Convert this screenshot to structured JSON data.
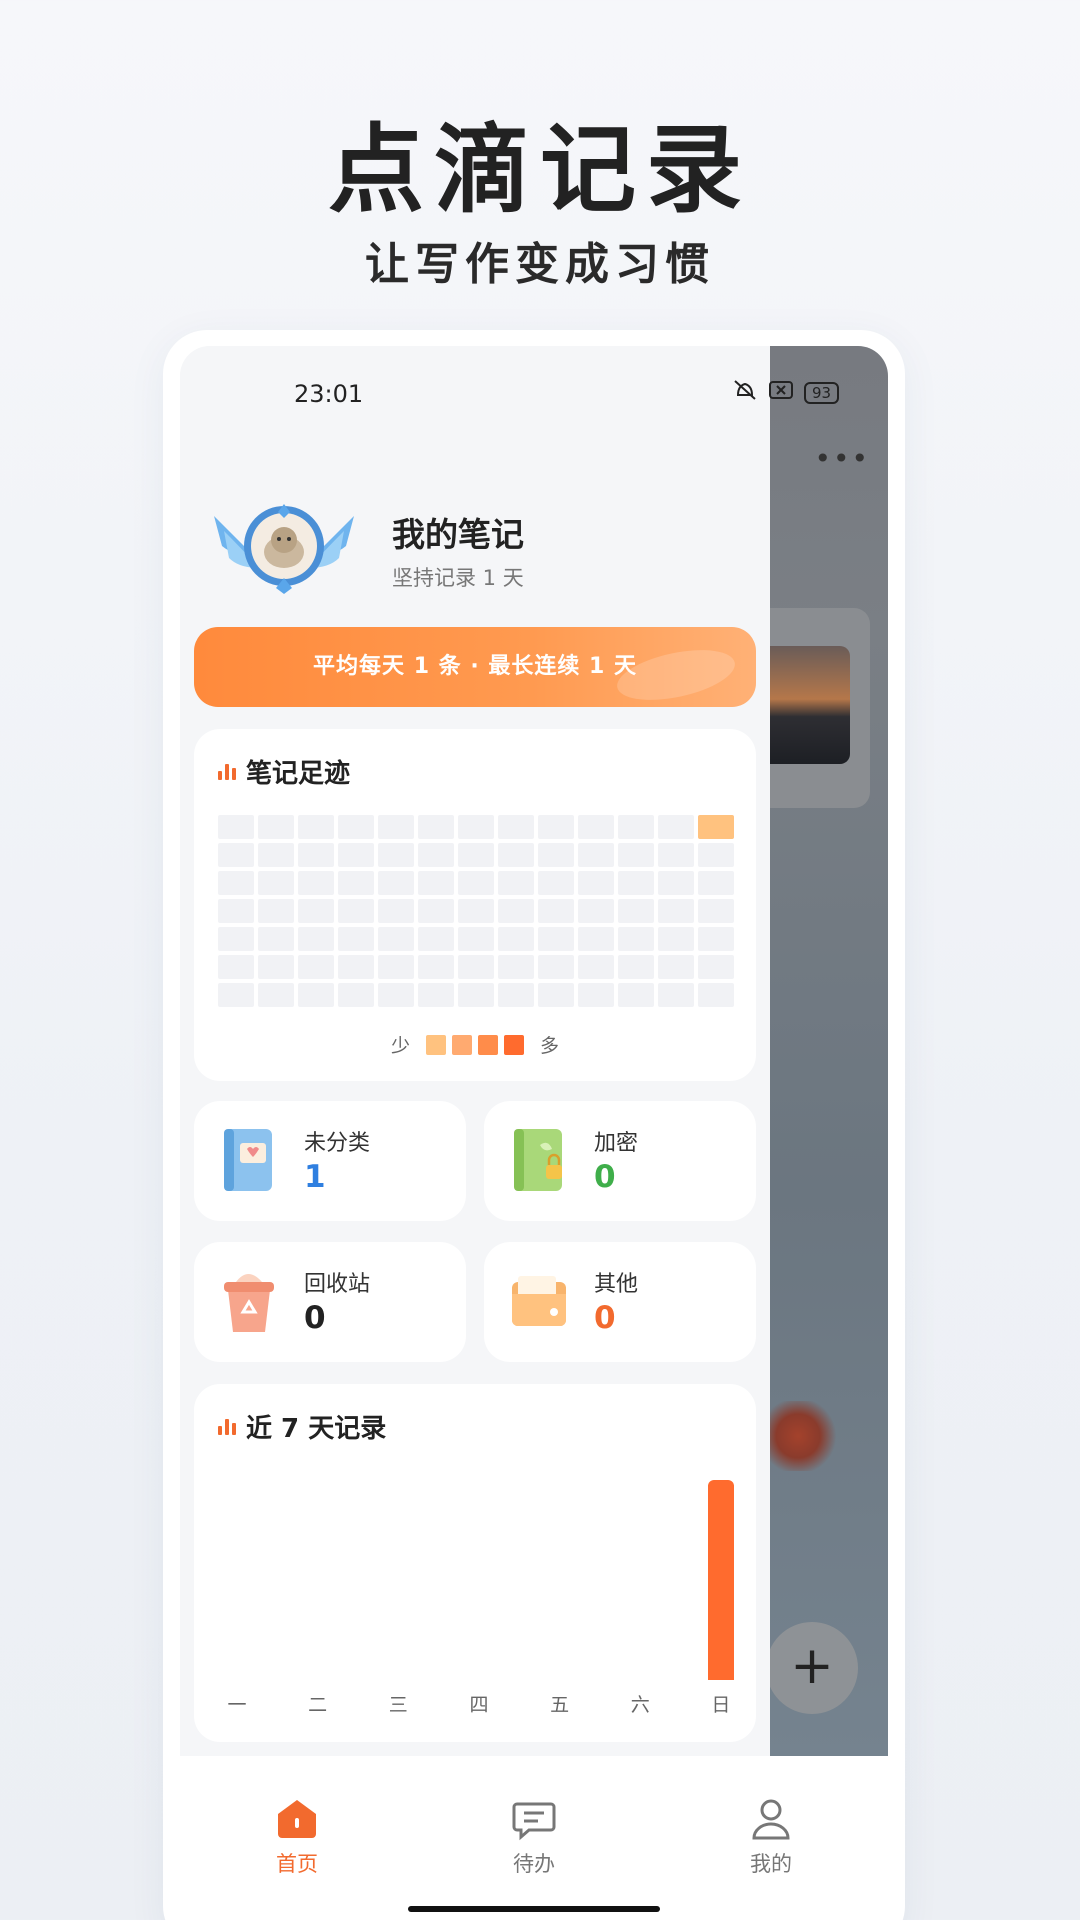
{
  "hero": {
    "title": "点滴记录",
    "subtitle": "让写作变成习惯"
  },
  "status_bar": {
    "time": "23:01",
    "battery": "93"
  },
  "profile": {
    "name": "我的笔记",
    "streak_text": "坚持记录 1 天"
  },
  "stats_banner": "平均每天 1 条 · 最长连续 1 天",
  "footprint": {
    "title": "笔记足迹",
    "rows": 7,
    "cols": 13,
    "active_cells": [
      [
        0,
        12
      ]
    ],
    "legend_less": "少",
    "legend_more": "多",
    "legend_colors": [
      "#ffc27f",
      "#ffaa70",
      "#ff8c4a",
      "#ff6b2e"
    ]
  },
  "categories": [
    {
      "label": "未分类",
      "count": "1",
      "color": "#2f7fe0",
      "icon": "blue-notebook-icon"
    },
    {
      "label": "加密",
      "count": "0",
      "color": "#3fae4a",
      "icon": "green-locked-notebook-icon"
    },
    {
      "label": "回收站",
      "count": "0",
      "color": "#222222",
      "icon": "recycle-bin-icon"
    },
    {
      "label": "其他",
      "count": "0",
      "color": "#f26a2e",
      "icon": "folder-icon"
    }
  ],
  "weekly": {
    "title": "近 7 天记录",
    "days": [
      "一",
      "二",
      "三",
      "四",
      "五",
      "六",
      "日"
    ],
    "values": [
      0,
      0,
      0,
      0,
      0,
      0,
      1
    ]
  },
  "tabs": [
    {
      "label": "首页",
      "active": true,
      "icon": "home-icon"
    },
    {
      "label": "待办",
      "active": false,
      "icon": "chat-icon"
    },
    {
      "label": "我的",
      "active": false,
      "icon": "person-icon"
    }
  ],
  "colors": {
    "accent": "#f26a2e",
    "inactive": "#777777"
  }
}
